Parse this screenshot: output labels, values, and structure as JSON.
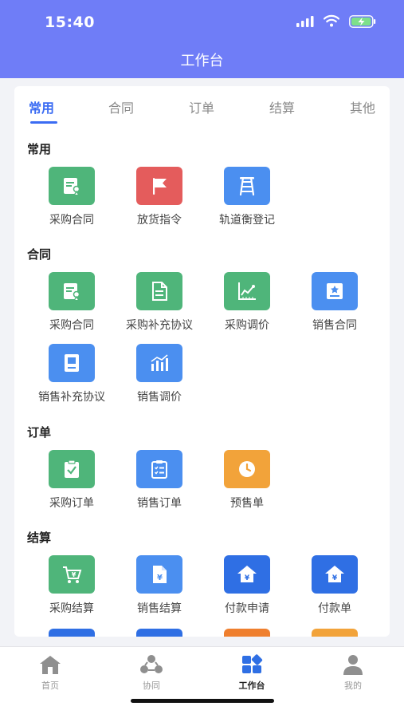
{
  "status": {
    "time": "15:40"
  },
  "header": {
    "title": "工作台"
  },
  "tabs": [
    "常用",
    "合同",
    "订单",
    "结算",
    "其他"
  ],
  "sections": [
    {
      "title": "常用",
      "items": [
        {
          "label": "采购合同",
          "icon": "contract-icon",
          "color": "#4fb57a"
        },
        {
          "label": "放货指令",
          "icon": "flag-icon",
          "color": "#e45c5c"
        },
        {
          "label": "轨道衡登记",
          "icon": "ladder-icon",
          "color": "#4b8ff0"
        }
      ]
    },
    {
      "title": "合同",
      "items": [
        {
          "label": "采购合同",
          "icon": "contract-icon",
          "color": "#4fb57a"
        },
        {
          "label": "采购补充协议",
          "icon": "document-icon",
          "color": "#4fb57a"
        },
        {
          "label": "采购调价",
          "icon": "chart-line-icon",
          "color": "#4fb57a"
        },
        {
          "label": "销售合同",
          "icon": "certificate-icon",
          "color": "#4b8ff0"
        },
        {
          "label": "销售补充协议",
          "icon": "book-icon",
          "color": "#4b8ff0"
        },
        {
          "label": "销售调价",
          "icon": "bar-chart-icon",
          "color": "#4b8ff0"
        }
      ]
    },
    {
      "title": "订单",
      "items": [
        {
          "label": "采购订单",
          "icon": "clipboard-check-icon",
          "color": "#4fb57a"
        },
        {
          "label": "销售订单",
          "icon": "clipboard-list-icon",
          "color": "#4b8ff0"
        },
        {
          "label": "预售单",
          "icon": "clock-icon",
          "color": "#f2a33a"
        }
      ]
    },
    {
      "title": "结算",
      "items": [
        {
          "label": "采购结算",
          "icon": "cart-yen-icon",
          "color": "#4fb57a"
        },
        {
          "label": "销售结算",
          "icon": "file-yen-icon",
          "color": "#4b8ff0"
        },
        {
          "label": "付款申请",
          "icon": "house-yen-icon",
          "color": "#2f6fe4"
        },
        {
          "label": "付款单",
          "icon": "house-yen-icon",
          "color": "#2f6fe4"
        }
      ]
    }
  ],
  "tabbar": [
    {
      "label": "首页",
      "icon": "home-icon"
    },
    {
      "label": "协同",
      "icon": "collaborate-icon"
    },
    {
      "label": "工作台",
      "icon": "workbench-icon"
    },
    {
      "label": "我的",
      "icon": "profile-icon"
    }
  ]
}
